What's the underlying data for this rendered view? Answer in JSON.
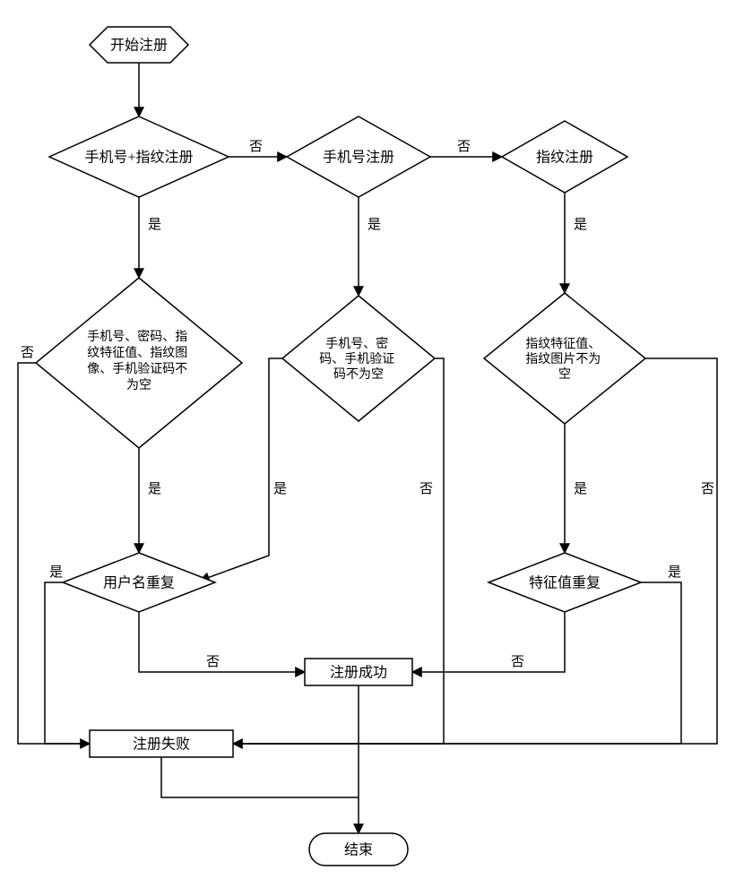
{
  "nodes": {
    "start": "开始注册",
    "d1": "手机号+指纹注册",
    "d2": "手机号注册",
    "d3": "指纹注册",
    "d4_l1": "手机号、密码、指",
    "d4_l2": "纹特征值、指纹图",
    "d4_l3": "像、手机验证码不",
    "d4_l4": "为空",
    "d5_l1": "手机号、密",
    "d5_l2": "码、手机验证",
    "d5_l3": "码不为空",
    "d6_l1": "指纹特征值、",
    "d6_l2": "指纹图片不为",
    "d6_l3": "空",
    "d7": "用户名重复",
    "d8": "特征值重复",
    "success": "注册成功",
    "fail": "注册失败",
    "end": "结束"
  },
  "labels": {
    "yes": "是",
    "no": "否"
  }
}
